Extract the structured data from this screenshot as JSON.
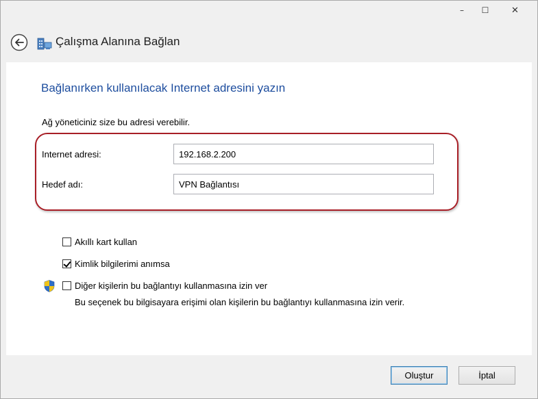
{
  "window": {
    "title": "Çalışma Alanına Bağlan",
    "caption_buttons": {
      "minimize": "–",
      "maximize": "☐",
      "close": "✕"
    }
  },
  "main": {
    "heading": "Bağlanırken kullanılacak Internet adresini yazın",
    "subtext": "Ağ yöneticiniz size bu adresi verebilir.",
    "internet_address": {
      "label": "Internet adresi:",
      "value": "192.168.2.200"
    },
    "destination_name": {
      "label": "Hedef adı:",
      "value": "VPN Bağlantısı"
    },
    "options": [
      {
        "label": "Akıllı kart kullan",
        "checked": false
      },
      {
        "label": "Kimlik bilgilerimi anımsa",
        "checked": true
      },
      {
        "label": "Diğer kişilerin bu bağlantıyı kullanmasına izin ver",
        "checked": false,
        "icon": "shield-icon"
      }
    ],
    "option_description": "Bu seçenek bu bilgisayara erişimi olan kişilerin bu bağlantıyı kullanmasına izin verir."
  },
  "footer": {
    "create_label": "Oluştur",
    "cancel_label": "İptal"
  },
  "colors": {
    "heading": "#1d4d9e",
    "highlight_ring": "#a81e26",
    "primary_button_border": "#3c7fb1"
  }
}
